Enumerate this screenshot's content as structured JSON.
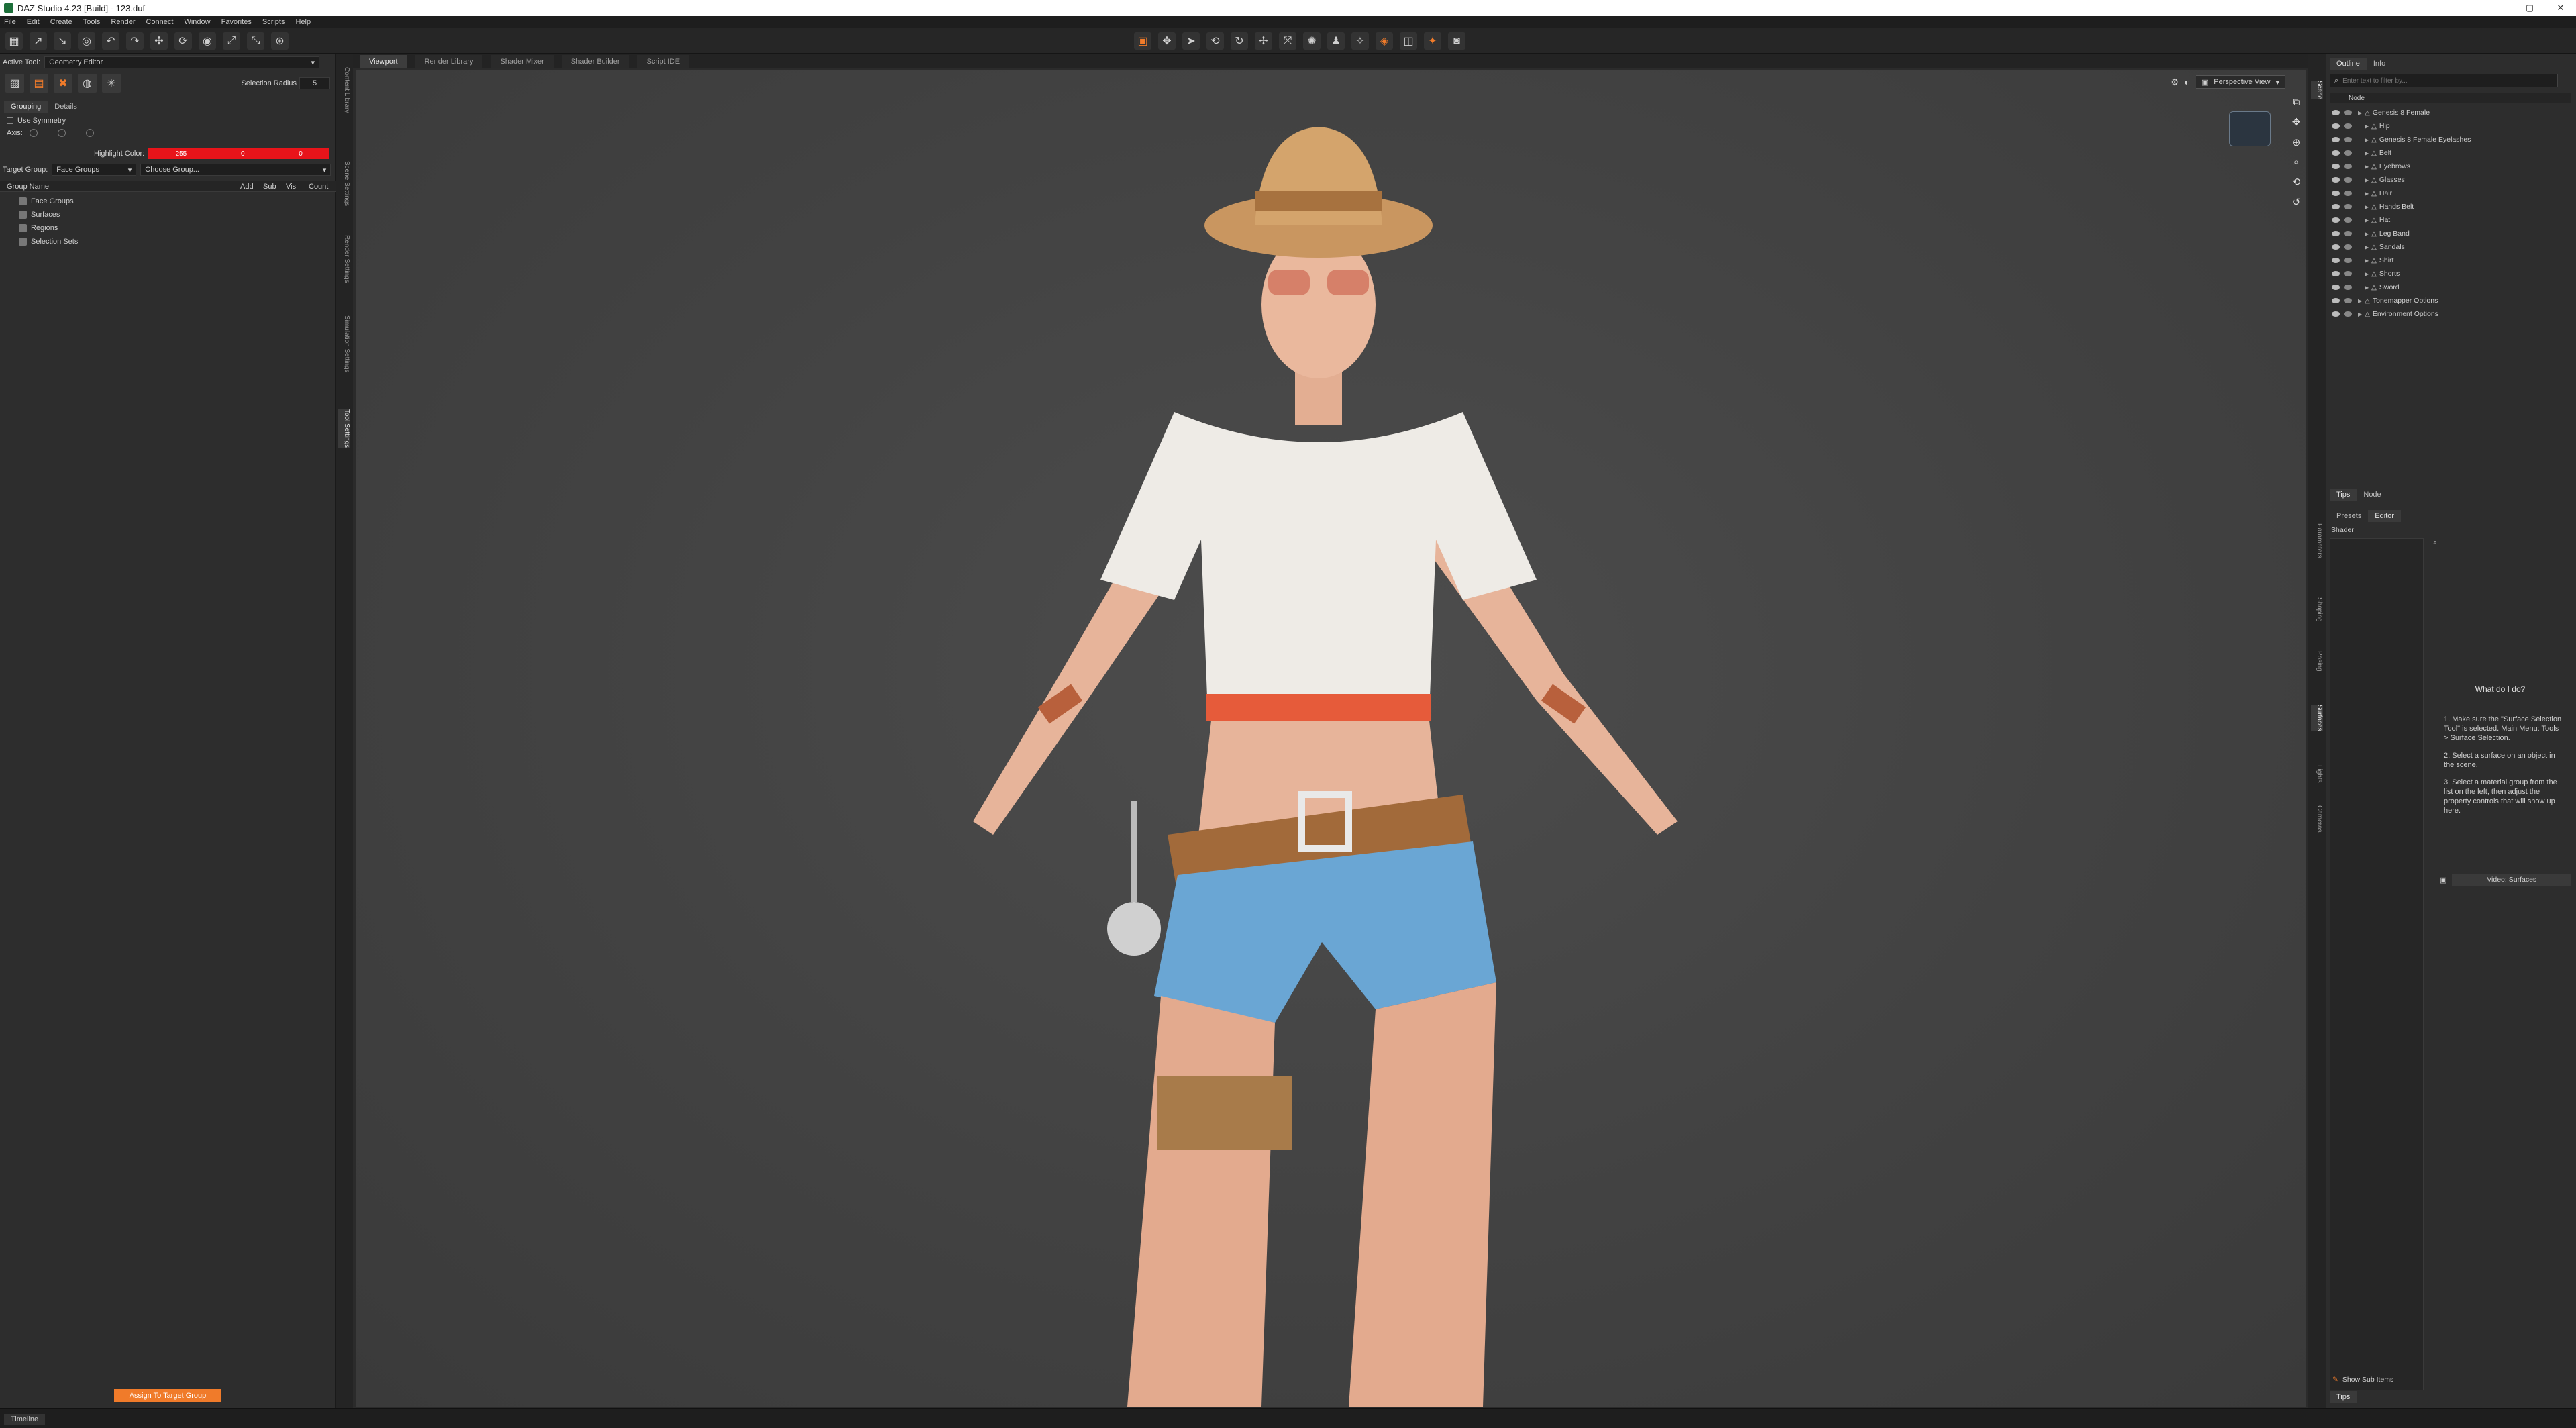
{
  "window": {
    "title": "DAZ Studio 4.23 [Build] - 123.duf",
    "min": "—",
    "max": "▢",
    "close": "✕"
  },
  "menu": [
    "File",
    "Edit",
    "Create",
    "Tools",
    "Render",
    "Connect",
    "Window",
    "Favorites",
    "Scripts",
    "Help"
  ],
  "left_panel": {
    "active_tool_label": "Active Tool:",
    "active_tool_value": "Geometry Editor",
    "selection_radius_label": "Selection Radius",
    "selection_radius_value": "5",
    "tabs": [
      "Grouping",
      "Details"
    ],
    "use_symmetry": "Use Symmetry",
    "axis_label": "Axis:",
    "highlight_color_label": "Highlight Color:",
    "highlight_color": {
      "r": "255",
      "g": "0",
      "b": "0"
    },
    "target_group_label": "Target Group:",
    "target_group_value": "Face Groups",
    "choose_group_value": "Choose Group...",
    "table_headers": {
      "name": "Group Name",
      "add": "Add",
      "sub": "Sub",
      "vis": "Vis",
      "count": "Count"
    },
    "groups": [
      "Face Groups",
      "Surfaces",
      "Regions",
      "Selection Sets"
    ],
    "assign_button": "Assign To Target Group",
    "vertical_tabs": [
      "Content Library",
      "Scene Settings",
      "Render Settings",
      "Simulation Settings",
      "Tool Settings"
    ]
  },
  "viewport": {
    "tabs": [
      "Viewport",
      "Render Library",
      "Shader Mixer",
      "Shader Builder",
      "Script IDE"
    ],
    "view_dropdown": "Perspective View"
  },
  "right_panel": {
    "top_tabs": [
      "Outline",
      "Info"
    ],
    "search_placeholder": "Enter text to filter by...",
    "node_header": "Node",
    "scene_nodes": [
      {
        "label": "Genesis 8 Female",
        "level": 0
      },
      {
        "label": "Hip",
        "level": 1
      },
      {
        "label": "Genesis 8 Female Eyelashes",
        "level": 1
      },
      {
        "label": "Belt",
        "level": 1
      },
      {
        "label": "Eyebrows",
        "level": 1
      },
      {
        "label": "Glasses",
        "level": 1
      },
      {
        "label": "Hair",
        "level": 1
      },
      {
        "label": "Hands Belt",
        "level": 1
      },
      {
        "label": "Hat",
        "level": 1
      },
      {
        "label": "Leg Band",
        "level": 1
      },
      {
        "label": "Sandals",
        "level": 1
      },
      {
        "label": "Shirt",
        "level": 1
      },
      {
        "label": "Shorts",
        "level": 1
      },
      {
        "label": "Sword",
        "level": 1
      },
      {
        "label": "Tonemapper Options",
        "level": 0
      },
      {
        "label": "Environment Options",
        "level": 0
      }
    ],
    "bottom_tabs_1": [
      "Tips",
      "Node"
    ],
    "editor_tabs": [
      "Presets",
      "Editor"
    ],
    "shader_label": "Shader",
    "tips_title": "What do I do?",
    "tips": [
      "1. Make sure the \"Surface Selection Tool\" is selected. Main Menu: Tools > Surface Selection.",
      "2. Select a surface on an object in the scene.",
      "3. Select a material group from the list on the left, then adjust the property controls that will show up here."
    ],
    "video_button": "Video: Surfaces",
    "show_sub_items": "Show Sub Items",
    "tips_tab": "Tips",
    "vertical_tabs": [
      "Scene",
      "Parameters",
      "Shaping",
      "Posing",
      "Surfaces",
      "Lights",
      "Cameras"
    ]
  },
  "bottom": {
    "timeline": "Timeline"
  },
  "colors": {
    "accent_orange": "#f07b2a",
    "highlight_red": "#e8141a",
    "panel": "#2d2d2d"
  }
}
